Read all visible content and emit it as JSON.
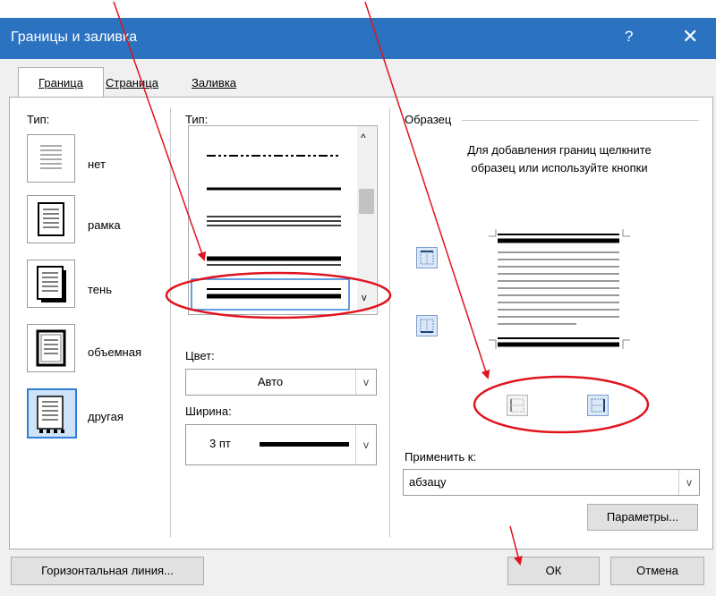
{
  "window": {
    "title": "Границы и заливка",
    "help": "?",
    "close": "✕"
  },
  "tabs": [
    {
      "label": "Граница",
      "active": true
    },
    {
      "label": "Страница",
      "active": false
    },
    {
      "label": "Заливка",
      "active": false
    }
  ],
  "left": {
    "type_label": "Тип:",
    "presets": [
      {
        "label": "нет",
        "icon": "none-border-icon"
      },
      {
        "label": "рамка",
        "icon": "box-border-icon"
      },
      {
        "label": "тень",
        "icon": "shadow-border-icon"
      },
      {
        "label": "объемная",
        "icon": "3d-border-icon"
      },
      {
        "label": "другая",
        "icon": "custom-border-icon"
      }
    ]
  },
  "middle": {
    "type_label": "Тип:",
    "color_label": "Цвет:",
    "color_value": "Авто",
    "width_label": "Ширина:",
    "width_value": "3 пт"
  },
  "right": {
    "sample_label": "Образец",
    "hint": "Для добавления границ щелкните образец или используйте кнопки",
    "apply_label": "Применить к:",
    "apply_value": "абзацу",
    "options_button": "Параметры..."
  },
  "footer": {
    "hline_button": "Горизонтальная линия...",
    "ok_button": "ОК",
    "cancel_button": "Отмена"
  },
  "colors": {
    "titlebar": "#2b72c1",
    "annotation": "#e0141e",
    "selection": "#2f7fd8"
  }
}
